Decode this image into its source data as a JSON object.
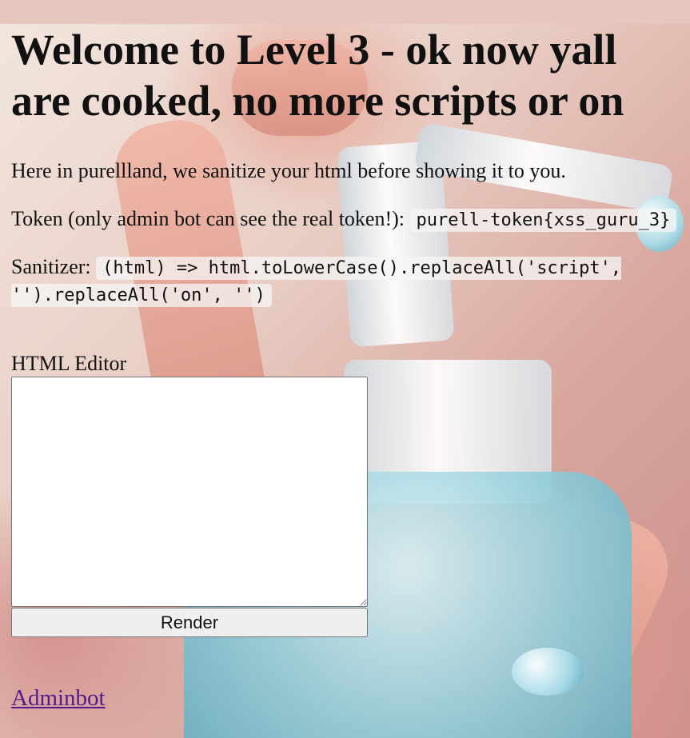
{
  "heading": "Welcome to Level 3 - ok now yall are cooked, no more scripts or on",
  "intro": "Here in purellland, we sanitize your html before showing it to you.",
  "token": {
    "label": "Token (only admin bot can see the real token!):",
    "value": "purell-token{xss_guru_3}"
  },
  "sanitizer": {
    "label": "Sanitizer:",
    "code": "(html) => html.toLowerCase().replaceAll('script', '').replaceAll('on', '')"
  },
  "editor": {
    "label": "HTML Editor",
    "value": "",
    "placeholder": ""
  },
  "render_button": "Render",
  "admin_link": "Adminbot"
}
